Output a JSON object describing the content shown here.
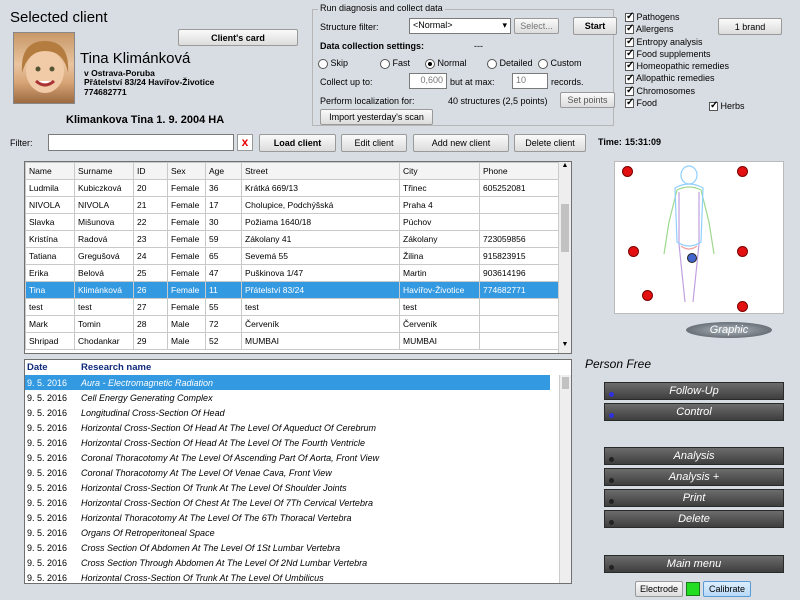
{
  "client_panel": {
    "title": "Selected client",
    "card_button": "Client's card",
    "name": "Tina Klimánková",
    "city_line": "v Ostrava-Poruba",
    "address_line": "Přátelství 83/24 Havířov-Životice",
    "phone": "774682771",
    "summary": "Klimankova Tina 1. 9. 2004 HA"
  },
  "diagnosis": {
    "title": "Run diagnosis and collect data",
    "structure_filter_label": "Structure filter:",
    "structure_filter_value": "<Normal>",
    "select_button": "Select...",
    "start_button": "Start",
    "settings_label": "Data collection settings:",
    "settings_value": "---",
    "modes": [
      {
        "label": "Skip",
        "checked": false
      },
      {
        "label": "Fast",
        "checked": false
      },
      {
        "label": "Normal",
        "checked": true
      },
      {
        "label": "Detailed",
        "checked": false
      },
      {
        "label": "Custom",
        "checked": false
      }
    ],
    "collect_label": "Collect up to:",
    "collect_value": "0,600",
    "max_label": "but at max:",
    "max_value": "10",
    "records_label": "records.",
    "localization_label": "Perform localization for:",
    "localization_value": "40 structures (2,5 points)",
    "set_points_button": "Set points",
    "import_button": "Import yesterday's scan",
    "brand_button": "1 brand",
    "categories": [
      {
        "label": "Pathogens",
        "checked": true
      },
      {
        "label": "Allergens",
        "checked": true
      },
      {
        "label": "Entropy analysis",
        "checked": true
      },
      {
        "label": "Food supplements",
        "checked": true
      },
      {
        "label": "Homeopathic remedies",
        "checked": true
      },
      {
        "label": "Allopathic remedies",
        "checked": true
      },
      {
        "label": "Chromosomes",
        "checked": true
      },
      {
        "label": "Food",
        "checked": true
      }
    ],
    "herbs": {
      "label": "Herbs",
      "checked": true
    }
  },
  "toolbar": {
    "filter_label": "Filter:",
    "filter_value": "",
    "clear_icon": "x",
    "load_client": "Load client",
    "edit_client": "Edit client",
    "add_client": "Add new client",
    "delete_client": "Delete client",
    "time_label": "Time:",
    "time_value": "15:31:09"
  },
  "clients": {
    "columns": [
      "Name",
      "Surname",
      "ID",
      "Sex",
      "Age",
      "Street",
      "City",
      "Phone"
    ],
    "rows": [
      [
        "Ludmila",
        "Kubiczková",
        "20",
        "Female",
        "36",
        "Krátká 669/13",
        "Třinec",
        "605252081"
      ],
      [
        "NIVOLA",
        "NIVOLA",
        "21",
        "Female",
        "17",
        "Cholupice, Podchýšská",
        "Praha 4",
        ""
      ],
      [
        "Slavka",
        "Mišunova",
        "22",
        "Female",
        "30",
        "Požiama 1640/18",
        "Púchov",
        ""
      ],
      [
        "Kristína",
        "Radová",
        "23",
        "Female",
        "59",
        "Zákolany 41",
        "Zákolany",
        "723059856"
      ],
      [
        "Tatiana",
        "Gregušová",
        "24",
        "Female",
        "65",
        "Sevemá 55",
        "Žilina",
        "915823915"
      ],
      [
        "Erika",
        "Belová",
        "25",
        "Female",
        "47",
        "Puškinova 1/47",
        "Martin",
        "903614196"
      ],
      [
        "Tina",
        "Klimánková",
        "26",
        "Female",
        "11",
        "Přátelství 83/24",
        "Havířov-Životice",
        "774682771"
      ],
      [
        "test",
        "test",
        "27",
        "Female",
        "55",
        "test",
        "test",
        ""
      ],
      [
        "Mark",
        "Tomin",
        "28",
        "Male",
        "72",
        "Červeník",
        "Červeník",
        ""
      ],
      [
        "Shripad",
        "Chodankar",
        "29",
        "Male",
        "52",
        "MUMBAI",
        "MUMBAI",
        ""
      ]
    ],
    "selected_index": 6
  },
  "research": {
    "columns": [
      "Date",
      "Research name"
    ],
    "rows": [
      [
        "9. 5. 2016",
        "Aura - Electromagnetic Radiation"
      ],
      [
        "9. 5. 2016",
        "Cell Energy Generating Complex"
      ],
      [
        "9. 5. 2016",
        "Longitudinal Cross-Section Of Head"
      ],
      [
        "9. 5. 2016",
        "Horizontal Cross-Section Of Head At The Level Of Aqueduct Of Cerebrum"
      ],
      [
        "9. 5. 2016",
        "Horizontal Cross-Section Of Head At The Level Of The Fourth Ventricle"
      ],
      [
        "9. 5. 2016",
        "Coronal Thoracotomy At The Level Of Ascending Part Of Aorta, Front View"
      ],
      [
        "9. 5. 2016",
        "Coronal Thoracotomy At The Level Of Venae Cava, Front View"
      ],
      [
        "9. 5. 2016",
        "Horizontal Cross-Section Of Trunk At The Level Of Shoulder Joints"
      ],
      [
        "9. 5. 2016",
        "Horizontal Cross-Section Of Chest At The Level Of 7Th Cervical Vertebra"
      ],
      [
        "9. 5. 2016",
        "Horizontal Thoracotomy At The Level Of The 6Th Thoracal Vertebra"
      ],
      [
        "9. 5. 2016",
        "Organs Of Retroperitoneal Space"
      ],
      [
        "9. 5. 2016",
        "Cross Section Of Abdomen At The Level Of 1St Lumbar Vertebra"
      ],
      [
        "9. 5. 2016",
        "Cross Section Through Abdomen At The Level Of 2Nd Lumbar Vertebra"
      ],
      [
        "9. 5. 2016",
        "Horizontal Cross-Section Of Trunk At The Level Of Umbilicus"
      ]
    ],
    "selected_index": 0
  },
  "side": {
    "graphic_button": "Graphic",
    "status": "Person Free",
    "follow_up": "Follow-Up",
    "control": "Control",
    "analysis": "Analysis",
    "analysis_plus": "Analysis +",
    "print": "Print",
    "delete": "Delete",
    "main_menu": "Main menu",
    "electrode": "Electrode",
    "calibrate": "Calibrate"
  },
  "colors": {
    "selection": "#3399e0",
    "point_red": "#e21010",
    "electrode_indicator": "#22dd22",
    "dark_button": "#4a4a4a"
  }
}
